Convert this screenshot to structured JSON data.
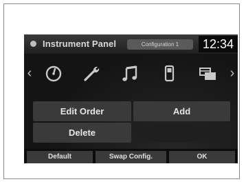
{
  "header": {
    "title": "Instrument Panel",
    "configuration": "Configuration 1",
    "clock": "12:34"
  },
  "icon_row": {
    "left_arrow": "‹",
    "right_arrow": "›",
    "icons": [
      "gauge-icon",
      "wrench-icon",
      "music-note-icon",
      "phone-icon",
      "screens-icon"
    ]
  },
  "actions": {
    "edit_order": "Edit Order",
    "add": "Add",
    "delete": "Delete"
  },
  "bottom": {
    "default": "Default",
    "swap": "Swap Config.",
    "ok": "OK"
  },
  "colors": {
    "screen_bg": "#141414",
    "button_bg": "#3a3a3a",
    "text": "#e6e6e6"
  }
}
